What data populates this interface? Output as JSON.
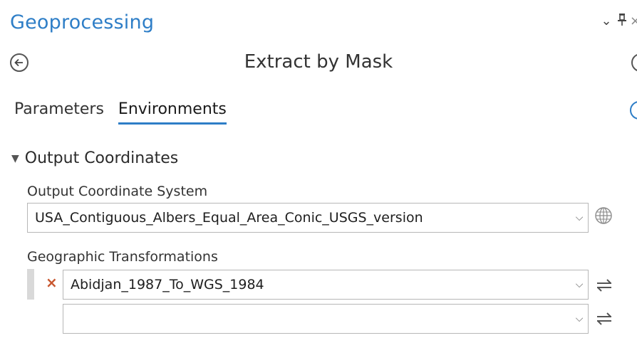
{
  "pane": {
    "title": "Geoprocessing"
  },
  "header_icons": {
    "dropdown": "chevron-down-icon",
    "pin": "pin-icon",
    "close": "close-icon"
  },
  "tool": {
    "title": "Extract by Mask"
  },
  "tabs": [
    {
      "label": "Parameters",
      "active": false
    },
    {
      "label": "Environments",
      "active": true
    }
  ],
  "section": {
    "title": "Output Coordinates",
    "output_cs": {
      "label": "Output Coordinate System",
      "value": "USA_Contiguous_Albers_Equal_Area_Conic_USGS_version"
    },
    "geo_transforms": {
      "label": "Geographic Transformations",
      "rows": [
        {
          "value": "Abidjan_1987_To_WGS_1984"
        },
        {
          "value": ""
        }
      ]
    }
  },
  "colors": {
    "accent": "#2e7ec7",
    "remove": "#c8562e",
    "border": "#b7b7b7"
  }
}
